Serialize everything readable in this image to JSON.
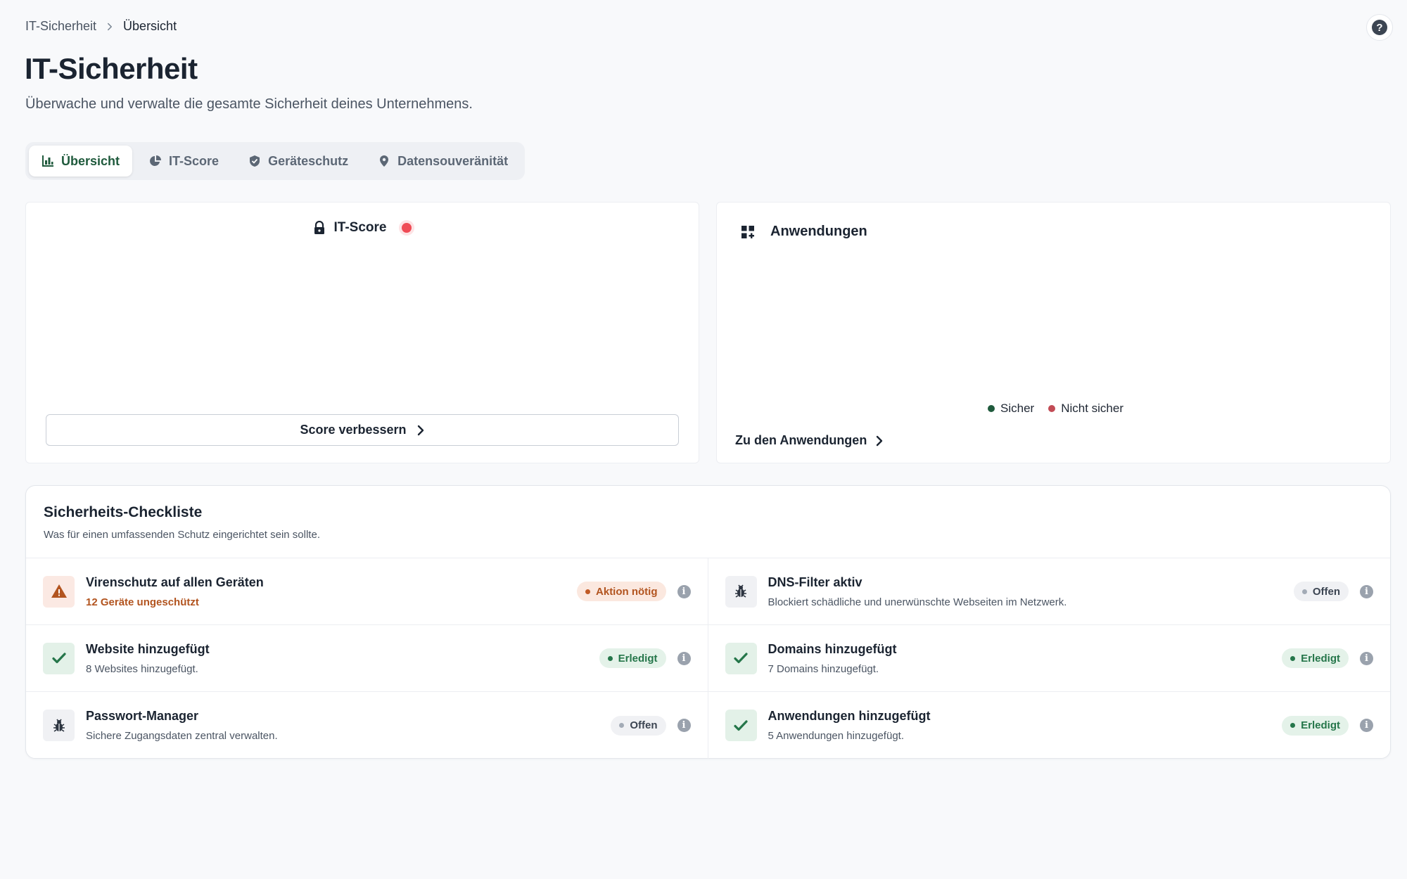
{
  "breadcrumb": {
    "root": "IT-Sicherheit",
    "current": "Übersicht"
  },
  "header": {
    "title": "IT-Sicherheit",
    "subtitle": "Überwache und verwalte die gesamte Sicherheit deines Unternehmens.",
    "help_icon": "question-icon"
  },
  "tabs": [
    {
      "label": "Übersicht",
      "icon": "bar-chart-icon",
      "active": true
    },
    {
      "label": "IT-Score",
      "icon": "pie-chart-icon",
      "active": false
    },
    {
      "label": "Geräteschutz",
      "icon": "shield-check-icon",
      "active": false
    },
    {
      "label": "Datensouveränität",
      "icon": "map-pin-icon",
      "active": false
    }
  ],
  "score_card": {
    "title": "IT-Score",
    "icon": "lock-icon",
    "status_color": "#ef4b55",
    "button_label": "Score verbessern"
  },
  "apps_card": {
    "title": "Anwendungen",
    "icon": "apps-add-icon",
    "legend": [
      {
        "label": "Sicher",
        "color": "#1f5a3c"
      },
      {
        "label": "Nicht sicher",
        "color": "#c24b55"
      }
    ],
    "link_label": "Zu den Anwendungen"
  },
  "checklist": {
    "title": "Sicherheits-Checkliste",
    "subtitle": "Was für einen umfassenden Schutz eingerichtet sein sollte.",
    "items": [
      {
        "name": "Virenschutz auf allen Geräten",
        "desc": "12 Geräte ungeschützt",
        "status": "Aktion nötig",
        "kind": "warn",
        "icon": "warning-icon"
      },
      {
        "name": "DNS-Filter aktiv",
        "desc": "Blockiert schädliche und unerwünschte Webseiten im Netzwerk.",
        "status": "Offen",
        "kind": "open",
        "icon": "bug-icon"
      },
      {
        "name": "Website hinzugefügt",
        "desc": "8 Websites hinzugefügt.",
        "status": "Erledigt",
        "kind": "ok",
        "icon": "check-icon"
      },
      {
        "name": "Domains hinzugefügt",
        "desc": "7 Domains hinzugefügt.",
        "status": "Erledigt",
        "kind": "ok",
        "icon": "check-icon"
      },
      {
        "name": "Passwort-Manager",
        "desc": "Sichere Zugangsdaten zentral verwalten.",
        "status": "Offen",
        "kind": "open",
        "icon": "bug-icon"
      },
      {
        "name": "Anwendungen hinzugefügt",
        "desc": "5 Anwendungen hinzugefügt.",
        "status": "Erledigt",
        "kind": "ok",
        "icon": "check-icon"
      }
    ]
  }
}
